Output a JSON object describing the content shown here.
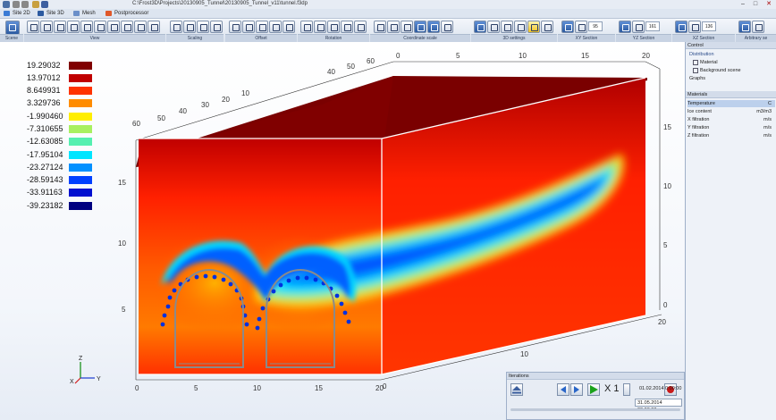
{
  "titlebar": {
    "path": "C:\\Frost3D\\Projects\\20130905_Tunnel\\20130905_Tunnel_v11\\tunnel.f3dp",
    "min": "–",
    "max": "□",
    "close": "✕"
  },
  "ribbon_tabs": [
    {
      "label": "Site 2D",
      "color": "#3a7bd5"
    },
    {
      "label": "Site 3D",
      "color": "#2c5aa0"
    },
    {
      "label": "Mesh",
      "color": "#6b8fc9"
    },
    {
      "label": "Postprocessor",
      "color": "#e0582a"
    }
  ],
  "toolbar_groups": {
    "scene": "Scene",
    "view": "View",
    "scaling": "Scaling",
    "offset": "Offset",
    "rotation": "Rotation",
    "coord_scale": "Coordinate scale",
    "settings_3d": "3D settings",
    "xy": "XY Section",
    "yz": "YZ Section",
    "xz": "XZ Section",
    "arbitrary": "Arbitrary se"
  },
  "section_values": {
    "xy": "95",
    "yz": "161",
    "xz": "136"
  },
  "legend": [
    {
      "value": "19.29032",
      "color": "#800000"
    },
    {
      "value": "13.97012",
      "color": "#c00000"
    },
    {
      "value": "8.649931",
      "color": "#ff3300"
    },
    {
      "value": "3.329736",
      "color": "#ff8c00"
    },
    {
      "value": "-1.990460",
      "color": "#ffee00"
    },
    {
      "value": "-7.310655",
      "color": "#a8f060"
    },
    {
      "value": "-12.63085",
      "color": "#55f0b0"
    },
    {
      "value": "-17.95104",
      "color": "#00e5ff"
    },
    {
      "value": "-23.27124",
      "color": "#0090ff"
    },
    {
      "value": "-28.59143",
      "color": "#0040ff"
    },
    {
      "value": "-33.91163",
      "color": "#0010d0"
    },
    {
      "value": "-39.23182",
      "color": "#000080"
    }
  ],
  "axis": {
    "front_bottom": [
      "0",
      "5",
      "10",
      "15",
      "20"
    ],
    "front_left": [
      "5",
      "10",
      "15"
    ],
    "right_bottom": [
      "0",
      "10",
      "20"
    ],
    "right_side": [
      "0",
      "5",
      "10",
      "15"
    ],
    "top_back": [
      "0",
      "5",
      "10",
      "15",
      "20"
    ],
    "left_depth": [
      "10",
      "20",
      "30",
      "40",
      "50",
      "60"
    ],
    "top_depth": [
      "40",
      "50",
      "60"
    ],
    "triad_x": "X",
    "triad_y": "Y",
    "triad_z": "Z"
  },
  "panel": {
    "control_title": "Control",
    "distribution": "Distribution",
    "material": "Material",
    "background_scene": "Background scene",
    "graphs": "Graphs",
    "materials_title": "Materials",
    "rows": [
      {
        "name": "Temperature",
        "unit": "C"
      },
      {
        "name": "Ice content",
        "unit": "m3/m3"
      },
      {
        "name": "X filtration",
        "unit": "m/s"
      },
      {
        "name": "Y filtration",
        "unit": "m/s"
      },
      {
        "name": "Z filtration",
        "unit": "m/s"
      }
    ]
  },
  "iterations": {
    "title": "Iterations",
    "multiplier": "X 1",
    "start_date": "01.02.2014 0:00:00",
    "current_date": "31.05.2014 00:00:00"
  }
}
